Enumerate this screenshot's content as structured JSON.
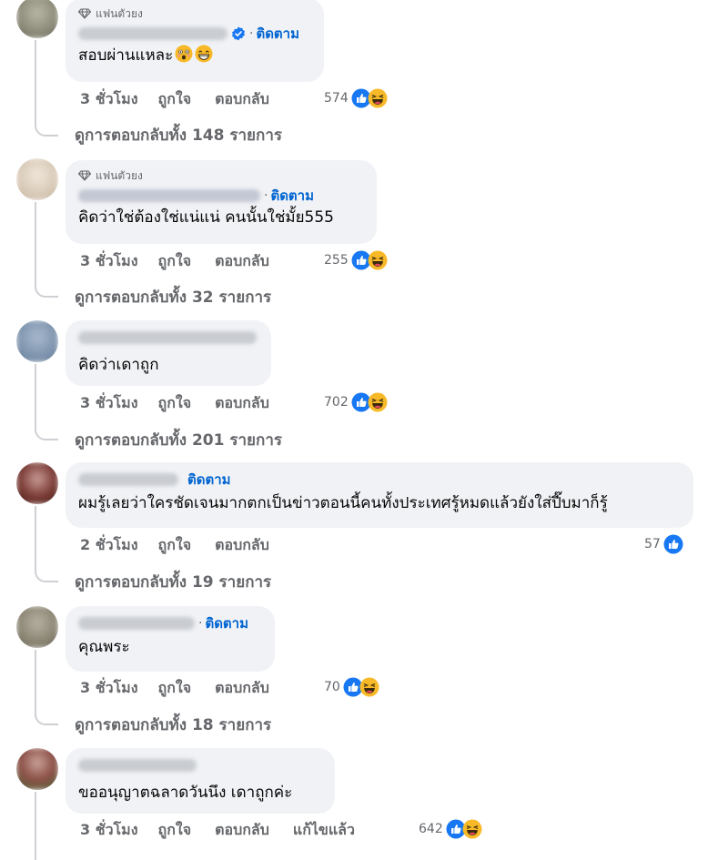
{
  "labels": {
    "top_fan": "แฟนตัวยง",
    "follow": "ติดตาม",
    "like": "ถูกใจ",
    "reply": "ตอบกลับ",
    "edited": "แก้ไขแล้ว"
  },
  "comments": [
    {
      "text": "สอบผ่านแหละ",
      "time": "3 ชั่วโมง",
      "reactions": "574",
      "view_replies": "ดูการตอบกลับทั้ง 148 รายการ"
    },
    {
      "text": "คิดว่าใช่ต้องใช่แน่แน่ คนนั้นใช่มั้ย555",
      "time": "3 ชั่วโมง",
      "reactions": "255",
      "view_replies": "ดูการตอบกลับทั้ง 32 รายการ"
    },
    {
      "text": "คิดว่าเดาถูก",
      "time": "3 ชั่วโมง",
      "reactions": "702",
      "view_replies": "ดูการตอบกลับทั้ง 201 รายการ"
    },
    {
      "text": "ผมรู้เลยว่าใครชัดเจนมากตกเป็นข่าวตอนนี้คนทั้งประเทศรู้หมดแล้วยังใส่ปี๊บมาก็รู้",
      "time": "2 ชั่วโมง",
      "reactions": "57",
      "view_replies": "ดูการตอบกลับทั้ง 19 รายการ"
    },
    {
      "text": "คุณพระ",
      "time": "3 ชั่วโมง",
      "reactions": "70",
      "view_replies": "ดูการตอบกลับทั้ง 18 รายการ"
    },
    {
      "text": "ขออนุญาตฉลาดวันนึง เดาถูกค่ะ",
      "time": "3 ชั่วโมง",
      "reactions": "642"
    }
  ],
  "colors": {
    "accent": "#0064d1",
    "bubble": "#f0f2f5",
    "secondary_text": "#65676b",
    "like_blue": "#1877f2",
    "haha_yellow": "#f7b928"
  }
}
